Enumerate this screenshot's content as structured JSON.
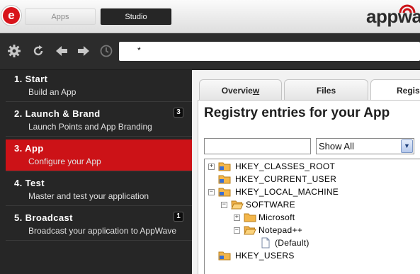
{
  "topbar": {
    "logo_letter": "e",
    "tabs": [
      "Apps",
      "Studio"
    ],
    "brand": "appwa",
    "accent": "#cc1217"
  },
  "toolbar": {
    "icons": [
      "gear-icon",
      "refresh-icon",
      "back-arrow-icon",
      "forward-arrow-icon",
      "history-clock-icon"
    ],
    "address_value": "*"
  },
  "sidebar": {
    "steps": [
      {
        "title": "1.  Start",
        "subtitle": "Build an App",
        "badge": ""
      },
      {
        "title": "2.  Launch  &  Brand",
        "subtitle": "Launch Points and App Branding",
        "badge": "3"
      },
      {
        "title": "3.  App",
        "subtitle": "Configure your App",
        "badge": ""
      },
      {
        "title": "4.  Test",
        "subtitle": "Master and test your application",
        "badge": ""
      },
      {
        "title": "5.  Broadcast",
        "subtitle": "Broadcast your application to AppWave",
        "badge": "1"
      }
    ]
  },
  "main": {
    "tabs": [
      "Overview",
      "Files",
      "Regis"
    ],
    "title": "Registry entries for your App",
    "filter_value": "",
    "select_value": "Show All",
    "tree": [
      {
        "label": "HKEY_CLASSES_ROOT",
        "expander": "+",
        "icon": "registry-folder-icon"
      },
      {
        "label": "HKEY_CURRENT_USER",
        "expander": "",
        "icon": "registry-folder-icon"
      },
      {
        "label": "HKEY_LOCAL_MACHINE",
        "expander": "−",
        "icon": "registry-folder-icon"
      },
      {
        "label": "SOFTWARE",
        "expander": "−",
        "icon": "open-folder-icon"
      },
      {
        "label": "Microsoft",
        "expander": "+",
        "icon": "folder-icon"
      },
      {
        "label": "Notepad++",
        "expander": "−",
        "icon": "open-folder-icon"
      },
      {
        "label": "(Default)",
        "expander": "",
        "icon": "document-icon"
      },
      {
        "label": "HKEY_USERS",
        "expander": "",
        "icon": "registry-folder-icon"
      }
    ]
  }
}
